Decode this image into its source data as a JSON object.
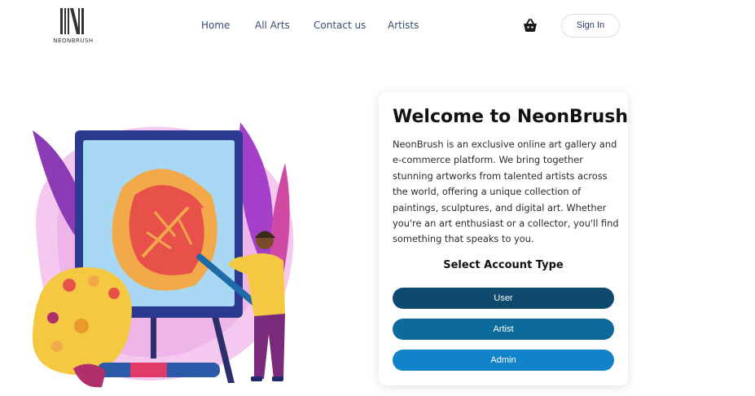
{
  "brand": {
    "name": "NEONBRUSH"
  },
  "nav": {
    "home": "Home",
    "all_arts": "All Arts",
    "contact": "Contact us",
    "artists": "Artists"
  },
  "header": {
    "signin_label": "Sign In",
    "cart_icon": "shopping-basket-icon"
  },
  "card": {
    "title": "Welcome to NeonBrush",
    "description": "NeonBrush is an exclusive online art gallery and e-commerce platform. We bring together stunning artworks from talented artists across the world, offering a unique collection of paintings, sculptures, and digital art. Whether you're an art enthusiast or a collector, you'll find something that speaks to you.",
    "select_label": "Select Account Type",
    "buttons": {
      "user": "User",
      "artist": "Artist",
      "admin": "Admin"
    }
  },
  "colors": {
    "user_button": "#0e4a6e",
    "artist_button": "#0d6a9c",
    "admin_button": "#1183c8",
    "nav_text": "#3a4a7a"
  }
}
